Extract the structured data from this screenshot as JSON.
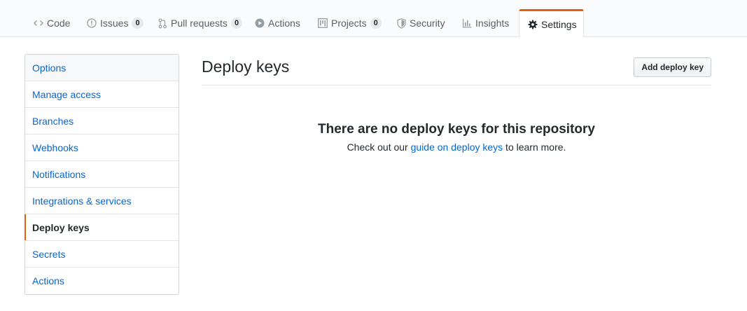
{
  "repo_nav": {
    "tabs": [
      {
        "label": "Code",
        "icon": "code-icon"
      },
      {
        "label": "Issues",
        "icon": "issue-icon",
        "count": "0"
      },
      {
        "label": "Pull requests",
        "icon": "pull-request-icon",
        "count": "0"
      },
      {
        "label": "Actions",
        "icon": "play-icon"
      },
      {
        "label": "Projects",
        "icon": "project-icon",
        "count": "0"
      },
      {
        "label": "Security",
        "icon": "shield-icon"
      },
      {
        "label": "Insights",
        "icon": "graph-icon"
      },
      {
        "label": "Settings",
        "icon": "gear-icon",
        "selected": true
      }
    ],
    "accent_color": "#e36209"
  },
  "sidebar": {
    "items": [
      {
        "label": "Options"
      },
      {
        "label": "Manage access"
      },
      {
        "label": "Branches"
      },
      {
        "label": "Webhooks"
      },
      {
        "label": "Notifications"
      },
      {
        "label": "Integrations & services"
      },
      {
        "label": "Deploy keys",
        "selected": true
      },
      {
        "label": "Secrets"
      },
      {
        "label": "Actions"
      }
    ]
  },
  "main": {
    "title": "Deploy keys",
    "add_button_label": "Add deploy key",
    "blankslate": {
      "title": "There are no deploy keys for this repository",
      "text_before": "Check out our ",
      "link_label": "guide on deploy keys",
      "text_after": " to learn more."
    }
  },
  "colors": {
    "link": "#0366d6",
    "text": "#24292e",
    "muted": "#586069",
    "selected_accent": "#e36209"
  }
}
